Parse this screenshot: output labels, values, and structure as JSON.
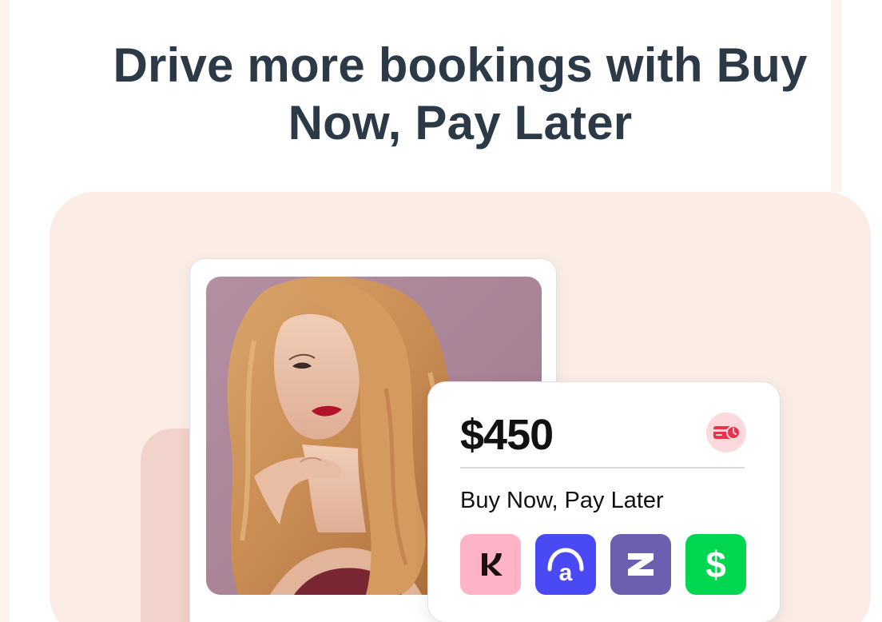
{
  "hero": {
    "headline": "Drive more bookings with Buy Now, Pay Later"
  },
  "payment_card": {
    "price": "$450",
    "badge_icon": "card-clock-icon",
    "label": "Buy Now, Pay Later",
    "providers": [
      {
        "name": "Klarna",
        "icon": "klarna-k-icon",
        "color": "#ffb3c7"
      },
      {
        "name": "Affirm",
        "icon": "affirm-a-icon",
        "color": "#4a4af4"
      },
      {
        "name": "Zip",
        "icon": "zip-z-icon",
        "color": "#6c5fb0"
      },
      {
        "name": "Cash App",
        "icon": "cash-app-dollar-icon",
        "color": "#00d64f"
      }
    ]
  },
  "colors": {
    "headline_text": "#2b3a46",
    "panel_background": "#fbede6",
    "accent_block": "#f1d3cc",
    "badge_background": "#fcd9dc",
    "badge_icon": "#e8334a"
  }
}
